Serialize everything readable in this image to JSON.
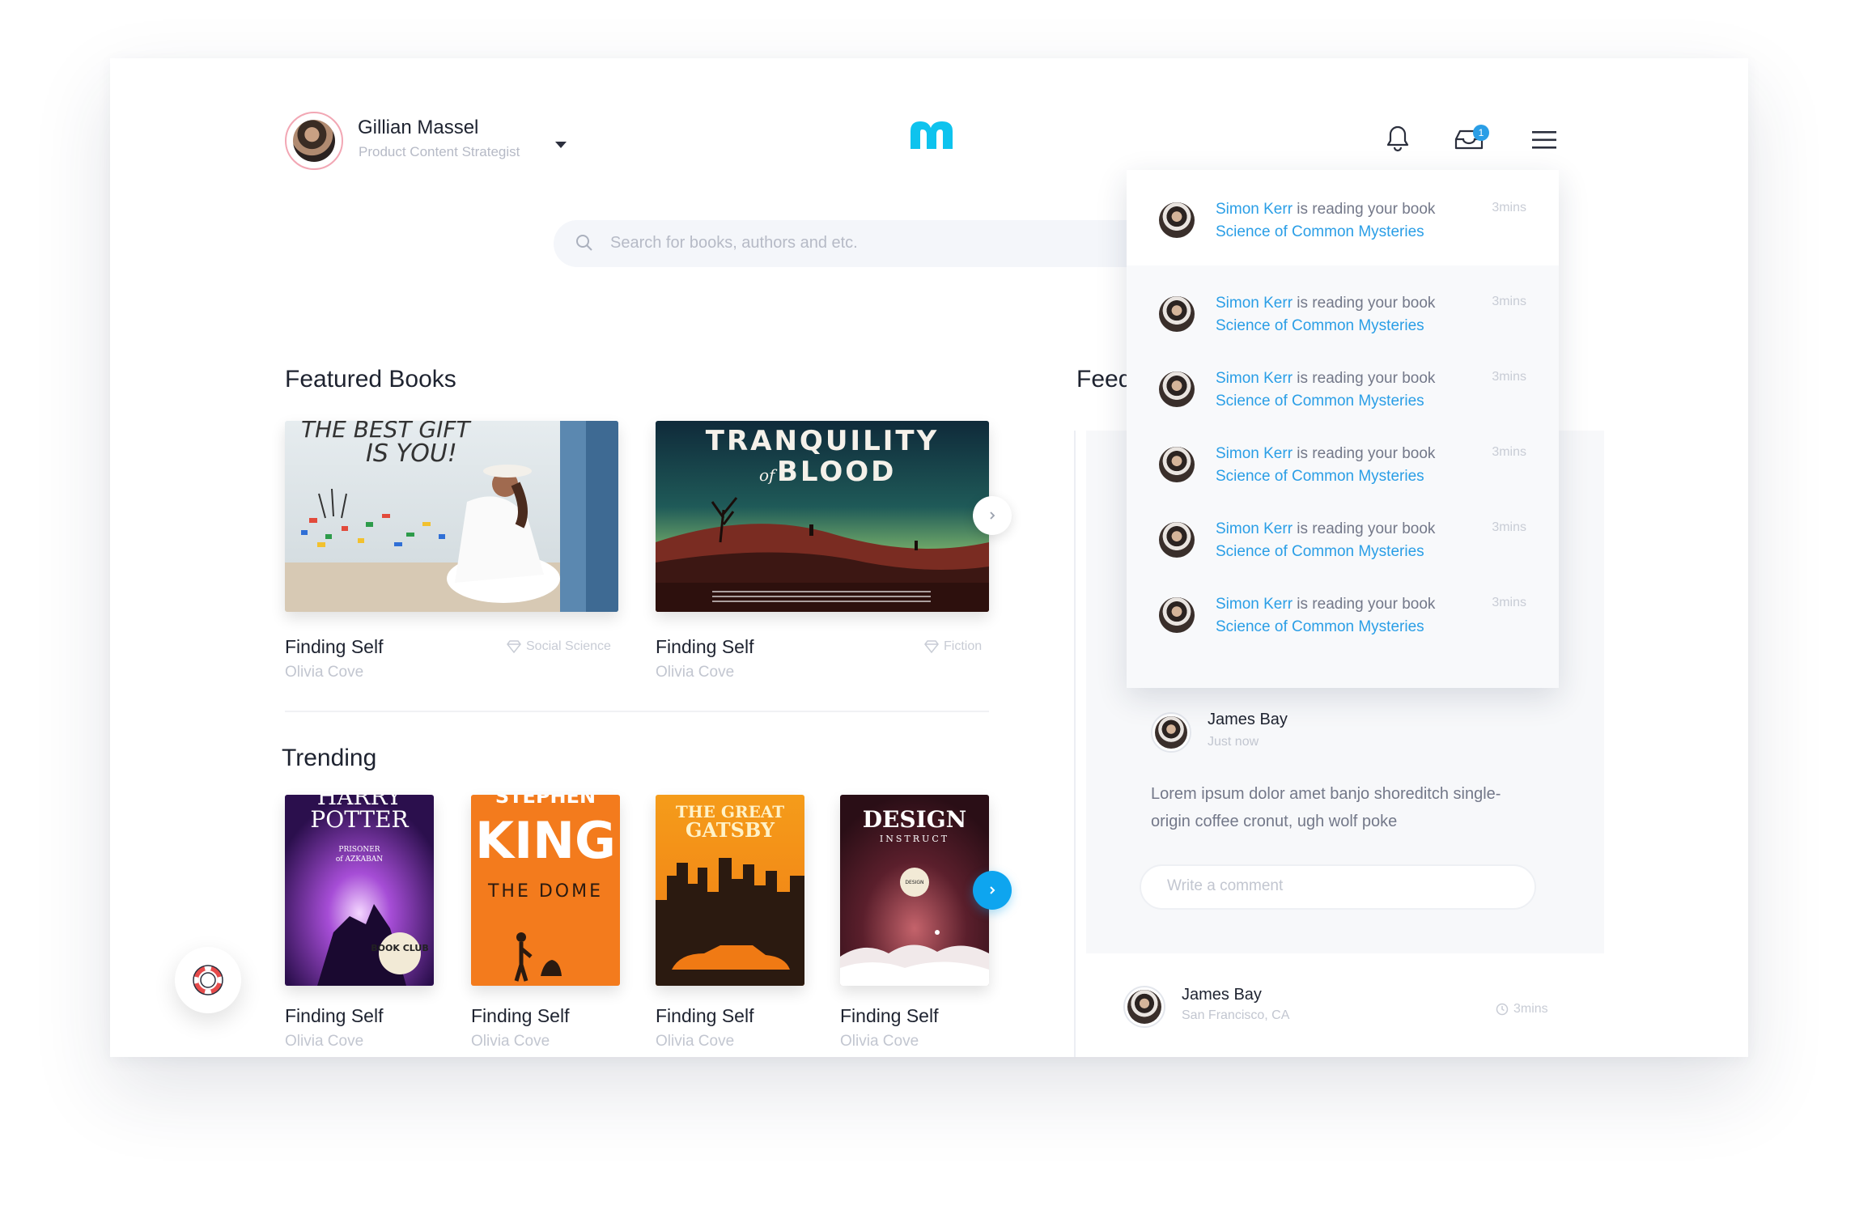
{
  "user": {
    "name": "Gillian Massel",
    "role": "Product Content Strategist"
  },
  "header": {
    "notification_count": "1"
  },
  "search": {
    "placeholder": "Search for books, authors and etc."
  },
  "featured": {
    "title": "Featured Books",
    "books": [
      {
        "title": "Finding Self",
        "author": "Olivia Cove",
        "genre": "Social Science",
        "cover_text": "THE BEST GIFT IS YOU!"
      },
      {
        "title": "Finding Self",
        "author": "Olivia Cove",
        "genre": "Fiction",
        "cover_text": "TRANQUILITY of BLOOD"
      }
    ]
  },
  "trending": {
    "title": "Trending",
    "books": [
      {
        "title": "Finding Self",
        "author": "Olivia Cove",
        "cover_line1": "HARRY",
        "cover_line2": "POTTER",
        "cover_sub": "and the PRISONER of AZKABAN",
        "badge": "BOOK CLUB"
      },
      {
        "title": "Finding Self",
        "author": "Olivia Cove",
        "cover_line1": "STEPHEN",
        "cover_line2": "KING",
        "cover_sub": "THE DOME"
      },
      {
        "title": "Finding Self",
        "author": "Olivia Cove",
        "cover_line1": "THE GREAT",
        "cover_line2": "GATSBY"
      },
      {
        "title": "Finding Self",
        "author": "Olivia Cove",
        "cover_line1": "DESIGN",
        "cover_line2": "INSTRUCT"
      }
    ]
  },
  "feed": {
    "title": "Feed",
    "post": {
      "author": "James Bay",
      "time": "Just now",
      "text_line1": "Lorem ipsum dolor amet banjo shoreditch single-",
      "text_line2": "origin coffee cronut, ugh wolf poke",
      "comment_placeholder": "Write a comment"
    },
    "second_post": {
      "author": "James Bay",
      "location": "San Francisco, CA",
      "time": "3mins"
    }
  },
  "notifications": [
    {
      "name": "Simon Kerr",
      "action": " is reading your book",
      "book": "Science of Common Mysteries",
      "time": "3mins"
    },
    {
      "name": "Simon Kerr",
      "action": " is reading your book",
      "book": "Science of Common Mysteries",
      "time": "3mins"
    },
    {
      "name": "Simon Kerr",
      "action": " is reading your book",
      "book": "Science of Common Mysteries",
      "time": "3mins"
    },
    {
      "name": "Simon Kerr",
      "action": " is reading your book",
      "book": "Science of Common Mysteries",
      "time": "3mins"
    },
    {
      "name": "Simon Kerr",
      "action": " is reading your book",
      "book": "Science of Common Mysteries",
      "time": "3mins"
    },
    {
      "name": "Simon Kerr",
      "action": " is reading your book",
      "book": "Science of Common Mysteries",
      "time": "3mins"
    }
  ],
  "colors": {
    "accent": "#0ea5ef",
    "link": "#2a9ee6",
    "avatar_ring": "#f2a7b4"
  },
  "icons": [
    "bell-icon",
    "inbox-icon",
    "hamburger-menu-icon",
    "search-icon",
    "chevron-right-icon",
    "diamond-icon",
    "clock-icon",
    "lifebuoy-icon",
    "logo-icon"
  ]
}
